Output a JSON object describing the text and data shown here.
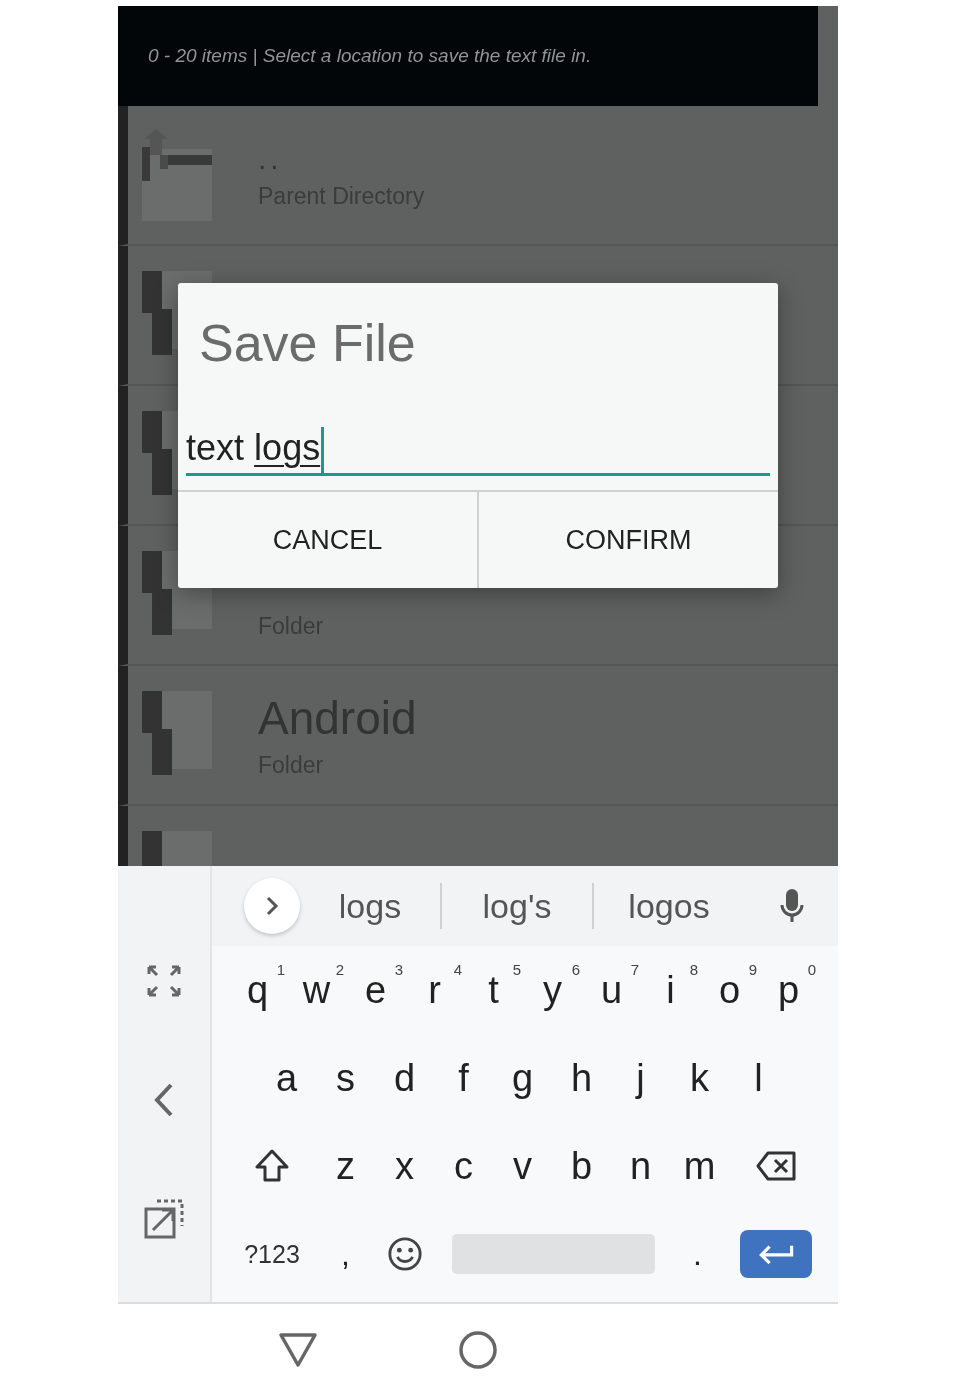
{
  "header": {
    "subtitle": "0 - 20 items | Select a location to save the text file in."
  },
  "files": [
    {
      "kind": "parent",
      "name": "..",
      "detail": "Parent Directory"
    },
    {
      "kind": "folder"
    },
    {
      "kind": "folder"
    },
    {
      "kind": "folder",
      "detail": "Folder"
    },
    {
      "kind": "folder",
      "name": "Android",
      "detail": "Folder"
    },
    {
      "kind": "folder"
    }
  ],
  "dialog": {
    "title": "Save File",
    "input": {
      "focused": true,
      "parts": [
        {
          "text": "text",
          "composing": false
        },
        {
          "text": "logs",
          "composing": true
        }
      ]
    },
    "buttons": [
      "CANCEL",
      "CONFIRM"
    ]
  },
  "keyboard": {
    "suggestions": [
      "logs",
      "log's",
      "logos"
    ],
    "rows": [
      [
        {
          "kind": "letter",
          "label": "q",
          "hint": "1"
        },
        {
          "kind": "letter",
          "label": "w",
          "hint": "2"
        },
        {
          "kind": "letter",
          "label": "e",
          "hint": "3"
        },
        {
          "kind": "letter",
          "label": "r",
          "hint": "4"
        },
        {
          "kind": "letter",
          "label": "t",
          "hint": "5"
        },
        {
          "kind": "letter",
          "label": "y",
          "hint": "6"
        },
        {
          "kind": "letter",
          "label": "u",
          "hint": "7"
        },
        {
          "kind": "letter",
          "label": "i",
          "hint": "8"
        },
        {
          "kind": "letter",
          "label": "o",
          "hint": "9"
        },
        {
          "kind": "letter",
          "label": "p",
          "hint": "0"
        }
      ],
      [
        {
          "kind": "letter",
          "label": "a"
        },
        {
          "kind": "letter",
          "label": "s"
        },
        {
          "kind": "letter",
          "label": "d"
        },
        {
          "kind": "letter",
          "label": "f"
        },
        {
          "kind": "letter",
          "label": "g"
        },
        {
          "kind": "letter",
          "label": "h"
        },
        {
          "kind": "letter",
          "label": "j"
        },
        {
          "kind": "letter",
          "label": "k"
        },
        {
          "kind": "letter",
          "label": "l"
        }
      ],
      [
        {
          "kind": "shift"
        },
        {
          "kind": "letter",
          "label": "z"
        },
        {
          "kind": "letter",
          "label": "x"
        },
        {
          "kind": "letter",
          "label": "c"
        },
        {
          "kind": "letter",
          "label": "v"
        },
        {
          "kind": "letter",
          "label": "b"
        },
        {
          "kind": "letter",
          "label": "n"
        },
        {
          "kind": "letter",
          "label": "m"
        },
        {
          "kind": "backspace"
        }
      ]
    ],
    "bottom_row": [
      {
        "kind": "symbols",
        "label": "?123"
      },
      {
        "kind": "char",
        "label": ","
      },
      {
        "kind": "emoji"
      },
      {
        "kind": "space"
      },
      {
        "kind": "period",
        "label": "."
      },
      {
        "kind": "enter"
      }
    ]
  }
}
